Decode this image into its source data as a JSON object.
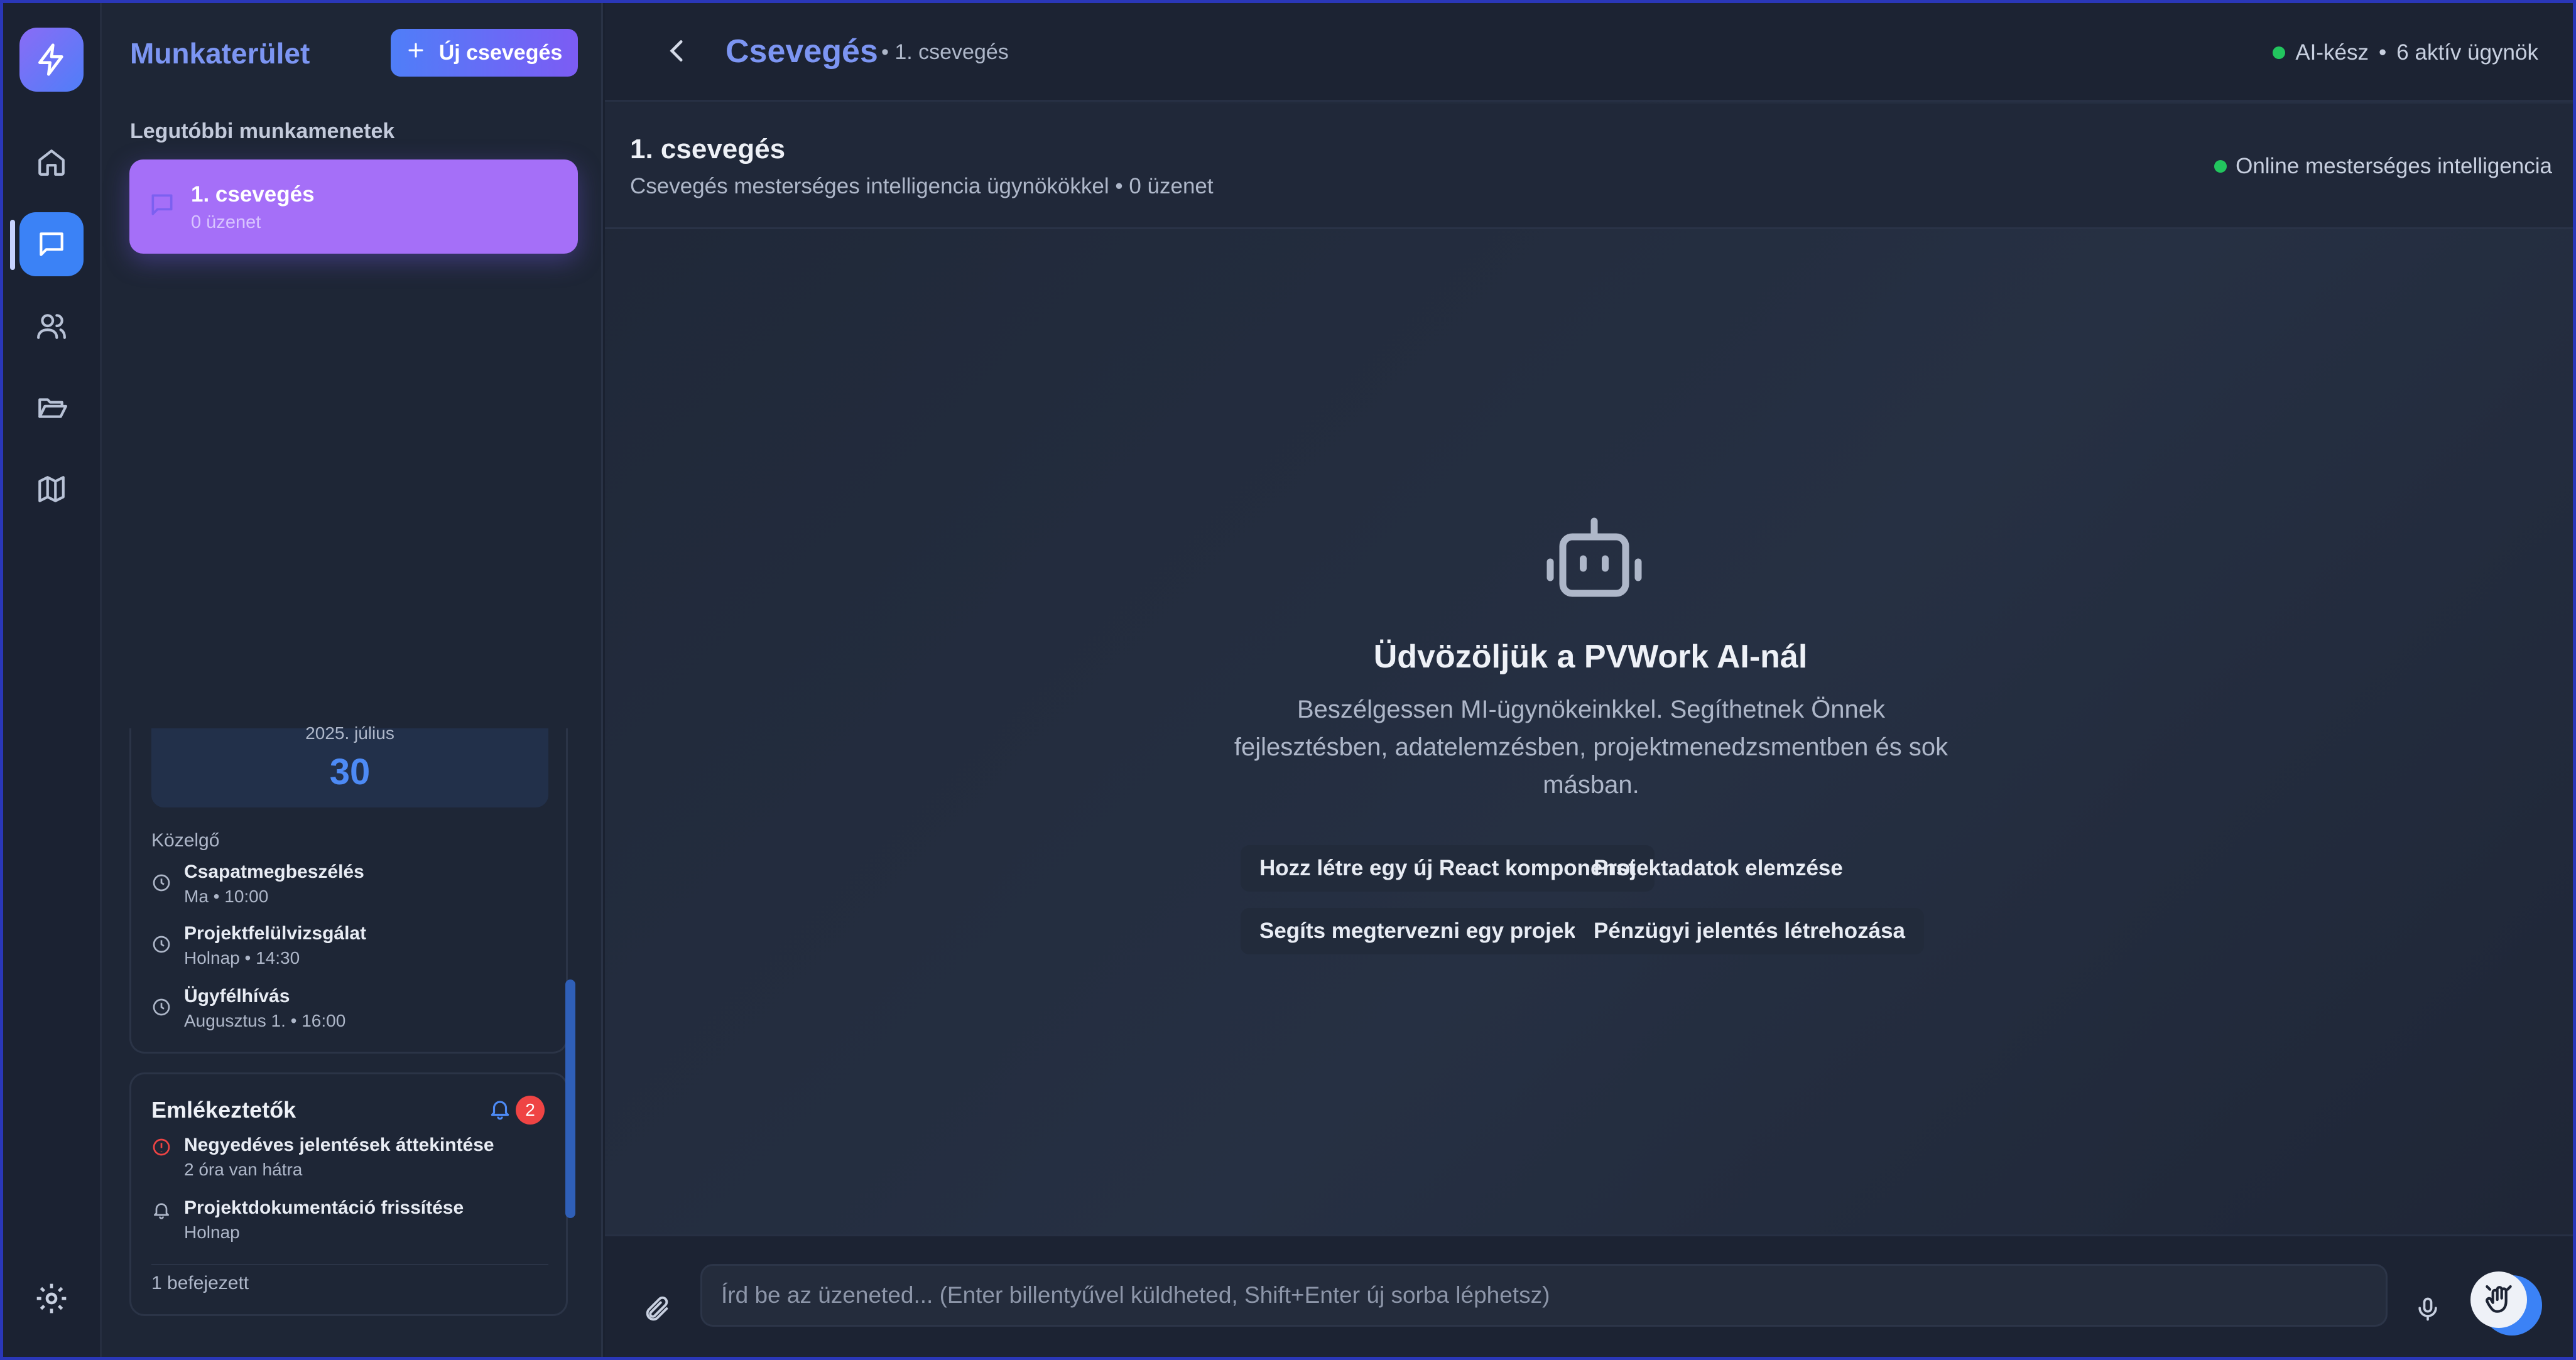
{
  "sidebar": {
    "workspace_title": "Munkaterület",
    "new_chat_label": "Új csevegés",
    "recent_sessions_label": "Legutóbbi munkamenetek",
    "sessions": [
      {
        "title": "1. csevegés",
        "subtitle": "0 üzenet"
      }
    ],
    "calendar": {
      "month": "2025. július",
      "day": "30",
      "upcoming_label": "Közelgő",
      "events": [
        {
          "title": "Csapatmegbeszélés",
          "time": "Ma • 10:00"
        },
        {
          "title": "Projektfelülvizsgálat",
          "time": "Holnap • 14:30"
        },
        {
          "title": "Ügyfélhívás",
          "time": "Augusztus 1. • 16:00"
        }
      ]
    },
    "reminders": {
      "title": "Emlékeztetők",
      "badge": "2",
      "items": [
        {
          "title": "Negyedéves jelentések áttekintése",
          "sub": "2 óra van hátra",
          "icon": "alert-circle-icon"
        },
        {
          "title": "Projektdokumentáció frissítése",
          "sub": "Holnap",
          "icon": "bell-icon"
        }
      ],
      "completed": "1 befejezett"
    }
  },
  "topbar": {
    "title": "Csevegés",
    "subtitle": "• 1. csevegés",
    "status": "AI-kész",
    "separator": "•",
    "agents": "6 aktív ügynök"
  },
  "chat_header": {
    "title": "1. csevegés",
    "subtitle": "Csevegés mesterséges intelligencia ügynökökkel • 0 üzenet",
    "online": "Online mesterséges intelligencia"
  },
  "welcome": {
    "title": "Üdvözöljük a PVWork AI-nál",
    "description": "Beszélgessen MI-ügynökeinkkel. Segíthetnek Önnek fejlesztésben, adatelemzésben, projektmenedzsmentben és sok másban.",
    "suggestions": [
      "Hozz létre egy új React komponenst",
      "Projektadatok elemzése",
      "Segíts megtervezni egy projektet",
      "Pénzügyi jelentés létrehozása"
    ]
  },
  "composer": {
    "placeholder": "Írd be az üzeneted... (Enter billentyűvel küldheted, Shift+Enter új sorba léphetsz)"
  },
  "colors": {
    "accent": "#3b82f6",
    "brand_title": "#7c95f2",
    "session_active": "#a56ff8",
    "online": "#22c55e",
    "badge": "#ef4444"
  }
}
